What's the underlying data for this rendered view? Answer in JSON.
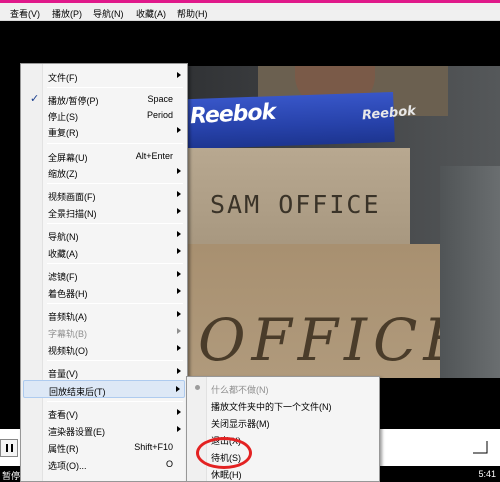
{
  "menubar": {
    "items": [
      "查看(V)",
      "播放(P)",
      "导航(N)",
      "收藏(A)",
      "帮助(H)"
    ]
  },
  "video": {
    "box_top_text": "Reebok",
    "box_top_text2": "Reebok",
    "box1_text": "SAM OFFICE",
    "box2_text": "OFFICE"
  },
  "context_menu": {
    "items": [
      {
        "label": "文件(F)",
        "shortcut": "",
        "submenu": true
      },
      {
        "label": "播放/暂停(P)",
        "shortcut": "Space",
        "checked": true
      },
      {
        "label": "停止(S)",
        "shortcut": "Period"
      },
      {
        "label": "重复(R)",
        "shortcut": "",
        "submenu": true
      },
      {
        "label": "全屏幕(U)",
        "shortcut": "Alt+Enter"
      },
      {
        "label": "缩放(Z)",
        "shortcut": "",
        "submenu": true
      },
      {
        "label": "视频画面(F)",
        "shortcut": "",
        "submenu": true
      },
      {
        "label": "全景扫描(N)",
        "shortcut": "",
        "submenu": true
      },
      {
        "label": "导航(N)",
        "shortcut": "",
        "submenu": true
      },
      {
        "label": "收藏(A)",
        "shortcut": "",
        "submenu": true
      },
      {
        "label": "滤镜(F)",
        "shortcut": "",
        "submenu": true
      },
      {
        "label": "着色器(H)",
        "shortcut": "",
        "submenu": true
      },
      {
        "label": "音频轨(A)",
        "shortcut": "",
        "submenu": true
      },
      {
        "label": "字幕轨(B)",
        "shortcut": "",
        "submenu": true,
        "disabled": true
      },
      {
        "label": "视频轨(O)",
        "shortcut": "",
        "submenu": true
      },
      {
        "label": "音量(V)",
        "shortcut": "",
        "submenu": true
      },
      {
        "label": "回放结束后(T)",
        "shortcut": "",
        "submenu": true,
        "highlighted": true
      },
      {
        "label": "查看(V)",
        "shortcut": "",
        "submenu": true
      },
      {
        "label": "渲染器设置(E)",
        "shortcut": "",
        "submenu": true
      },
      {
        "label": "属性(R)",
        "shortcut": "Shift+F10"
      },
      {
        "label": "选项(O)...",
        "shortcut": "O"
      }
    ]
  },
  "submenu": {
    "items": [
      {
        "label": "什么都不做(N)",
        "disabled": true,
        "radio": true
      },
      {
        "label": "播放文件夹中的下一个文件(N)"
      },
      {
        "label": "关闭显示器(M)"
      },
      {
        "label": "退出(X)"
      },
      {
        "label": "待机(S)"
      },
      {
        "label": "休眠(H)"
      }
    ]
  },
  "status": {
    "left": "暂停",
    "right": "5:41"
  },
  "colors": {
    "title_strip": "#e0198a",
    "annotation": "#e32222",
    "highlight": "#dde8f6"
  }
}
